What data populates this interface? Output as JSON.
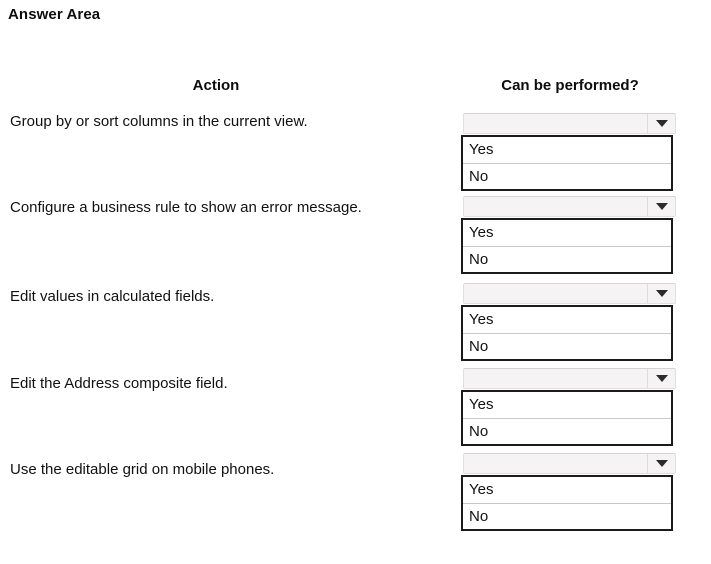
{
  "page": {
    "title": "Answer Area"
  },
  "table": {
    "headers": {
      "action": "Action",
      "can_be_performed": "Can be performed?"
    },
    "rows": [
      {
        "action": "Group by or sort columns in the current view.",
        "dropdown": {
          "selected": "",
          "placeholder": "",
          "options": [
            "Yes",
            "No"
          ],
          "expanded": true,
          "arrow_icon": "chevron-down-icon"
        }
      },
      {
        "action": "Configure a business rule to show an error message.",
        "dropdown": {
          "selected": "",
          "placeholder": "",
          "options": [
            "Yes",
            "No"
          ],
          "expanded": true,
          "arrow_icon": "chevron-down-icon"
        }
      },
      {
        "action": "Edit values in calculated fields.",
        "dropdown": {
          "selected": "",
          "placeholder": "",
          "options": [
            "Yes",
            "No"
          ],
          "expanded": true,
          "arrow_icon": "chevron-down-icon"
        }
      },
      {
        "action": "Edit the Address composite field.",
        "dropdown": {
          "selected": "",
          "placeholder": "",
          "options": [
            "Yes",
            "No"
          ],
          "expanded": true,
          "arrow_icon": "chevron-down-icon"
        }
      },
      {
        "action": "Use the editable grid on mobile phones.",
        "dropdown": {
          "selected": "",
          "placeholder": "",
          "options": [
            "Yes",
            "No"
          ],
          "expanded": true,
          "arrow_icon": "chevron-down-icon"
        }
      }
    ]
  },
  "colors": {
    "background": "#ffffff",
    "text": "#111111",
    "combobox_fill": "#f6f3f4",
    "combobox_border": "#e2dfe0",
    "list_border": "#1b1b1b",
    "option_divider": "#c8c8c8",
    "arrow": "#2b2b2b"
  }
}
